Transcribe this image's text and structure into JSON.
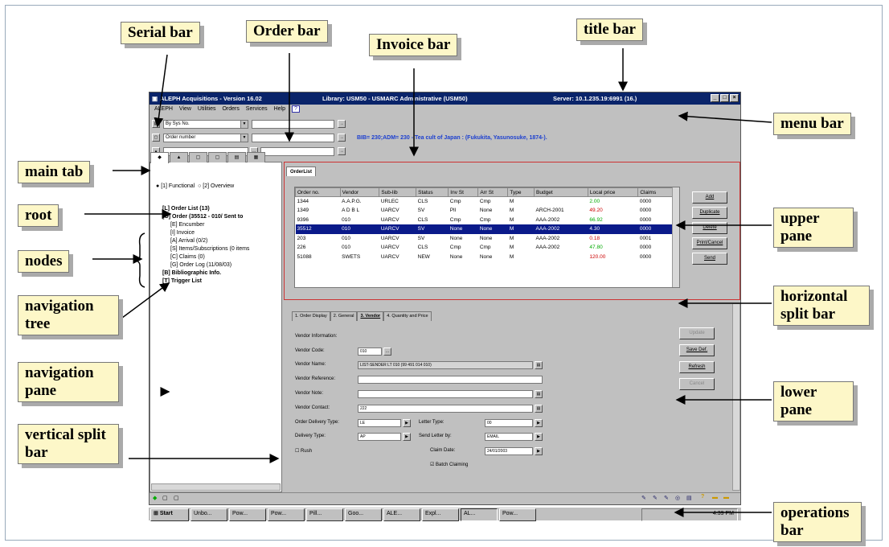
{
  "callouts": {
    "serial_bar": "Serial bar",
    "order_bar": "Order bar",
    "invoice_bar": "Invoice bar",
    "title_bar": "title  bar",
    "menu_bar": "menu bar",
    "main_tab": "main tab",
    "root": "root",
    "nodes": "nodes",
    "navigation_tree": "navigation tree",
    "navigation_pane": "navigation pane",
    "vertical_split_bar": "vertical split bar",
    "upper_pane": "upper pane",
    "horizontal_split_bar": "horizontal split bar",
    "lower_pane": "lower pane",
    "operations_bar": "operations bar"
  },
  "app": {
    "title": "ALEPH Acquisitions - Version 16.02",
    "library": "Library:  USM50 - USMARC Administrative (USM50)",
    "server": "Server:  10.1.235.19:6991 (16.)",
    "menu": [
      "ALEPH",
      "View",
      "Utilities",
      "Orders",
      "Services",
      "Help"
    ],
    "serial_select": "By Sys No.",
    "order_select": "Order number",
    "bib_line": "BIB= 230;ADM= 230 - Tea cult of Japan : (Fukukita, Yasunosuke, 1874-)."
  },
  "tree": {
    "radio_functional": "[1] Functional",
    "radio_overview": "[2] Overview",
    "items": [
      "[L] Order List (13)",
      "[O] Order (35512 - 010/ Sent to",
      "[E] Encumber",
      "[I] Invoice",
      "[A] Arrival (0/2)",
      "[S] Items/Subscriptions (0 items",
      "[C] Claims (0)",
      "[G] Order Log (11/08/03)",
      "[B] Bibliographic Info.",
      "[T] Trigger List"
    ]
  },
  "upper": {
    "tab": "OrderList",
    "columns": [
      "Order no.",
      "Vendor",
      "Sub-lib",
      "Status",
      "Inv St",
      "Arr St",
      "Type",
      "Budget",
      "Local price",
      "Claims"
    ],
    "rows": [
      [
        "1344",
        "A.A.P.G.",
        "URLEC",
        "CLS",
        "Cmp",
        "Cmp",
        "M",
        "",
        "2.00",
        "0000"
      ],
      [
        "1349",
        "A D B L",
        "UARCV",
        "SV",
        "Pll",
        "None",
        "M",
        "ARCH-2001",
        "49.20",
        "0000"
      ],
      [
        "9396",
        "010",
        "UARCV",
        "CLS",
        "Cmp",
        "Cmp",
        "M",
        "AAA-2002",
        "66.92",
        "0000"
      ],
      [
        "35512",
        "010",
        "UARCV",
        "SV",
        "None",
        "None",
        "M",
        "AAA-2002",
        "4.30",
        "0000"
      ],
      [
        "203",
        "010",
        "UARCV",
        "SV",
        "None",
        "None",
        "M",
        "AAA-2002",
        "0.18",
        "0001"
      ],
      [
        "226",
        "010",
        "UARCV",
        "CLS",
        "Cmp",
        "Cmp",
        "M",
        "AAA-2002",
        "47.80",
        "0000"
      ],
      [
        "51088",
        "SWETS",
        "UARCV",
        "NEW",
        "None",
        "None",
        "M",
        "",
        "120.00",
        "0000"
      ]
    ],
    "price_colors": [
      "green",
      "red",
      "green",
      "white",
      "red",
      "green",
      "red"
    ],
    "selected_row": 3,
    "buttons": [
      "Add",
      "Duplicate",
      "Delete",
      "Print/Cancel",
      "Send"
    ]
  },
  "lower": {
    "tabs": [
      "1. Order Display",
      "2. General",
      "3. Vendor",
      "4. Quantity and Price"
    ],
    "selected_tab": 2,
    "heading": "Vendor Information:",
    "vendor_code_label": "Vendor Code:",
    "vendor_code": "010",
    "vendor_name_label": "Vendor Name:",
    "vendor_name": "LIST-SENDER LT 010 (99 491 014 010)",
    "vendor_reference_label": "Vendor Reference:",
    "vendor_note_label": "Vendor Note:",
    "vendor_contact_label": "Vendor Contact:",
    "vendor_contact": "222",
    "order_delivery_type_label": "Order Delivery Type:",
    "order_delivery_type": "LE",
    "delivery_type_label": "Delivery Type:",
    "delivery_type": "AP",
    "letter_type_label": "Letter Type:",
    "letter_type": "00",
    "send_letter_by_label": "Send Letter by:",
    "send_letter_by": "EMAIL",
    "claim_date_label": "Claim Date:",
    "claim_date": "24/01/2003",
    "rush_label": "Rush",
    "batch_claiming_label": "Batch Claiming",
    "buttons": [
      "Update",
      "Save Def.",
      "Refresh",
      "Cancel"
    ]
  },
  "taskbar": {
    "start": "Start",
    "items": [
      "Unbo...",
      "Pow...",
      "Pow...",
      "Pill...",
      "Goo...",
      "ALE...",
      "Expl...",
      "AL...",
      "Pow..."
    ],
    "clock": "4:39 PM"
  }
}
